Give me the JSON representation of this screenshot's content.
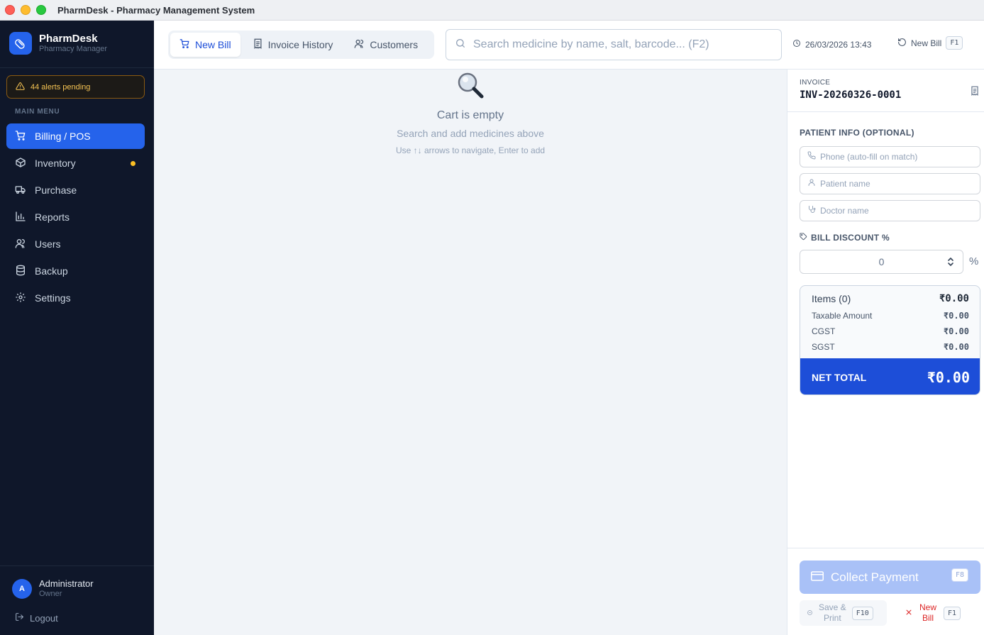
{
  "window": {
    "title": "PharmDesk - Pharmacy Management System"
  },
  "sidebar": {
    "brand_name": "PharmDesk",
    "brand_sub": "Pharmacy Manager",
    "alerts": "44 alerts pending",
    "menu_label": "MAIN MENU",
    "items": [
      {
        "label": "Billing / POS",
        "icon": "cart-icon",
        "active": true
      },
      {
        "label": "Inventory",
        "icon": "box-icon",
        "indicator": true
      },
      {
        "label": "Purchase",
        "icon": "truck-icon"
      },
      {
        "label": "Reports",
        "icon": "bar-chart-icon"
      },
      {
        "label": "Users",
        "icon": "users-icon"
      },
      {
        "label": "Backup",
        "icon": "database-icon"
      },
      {
        "label": "Settings",
        "icon": "gear-icon"
      }
    ],
    "user": {
      "initial": "A",
      "name": "Administrator",
      "role": "Owner"
    },
    "logout": "Logout"
  },
  "topbar": {
    "tabs": [
      {
        "label": "New Bill",
        "active": true
      },
      {
        "label": "Invoice History"
      },
      {
        "label": "Customers"
      }
    ],
    "search_placeholder": "Search medicine by name, salt, barcode... (F2)",
    "datetime": "26/03/2026 13:43",
    "new_bill_label": "New Bill",
    "new_bill_key": "F1"
  },
  "cart": {
    "empty_title": "Cart is empty",
    "empty_sub": "Search and add medicines above",
    "empty_hint": "Use ↑↓ arrows to navigate, Enter to add"
  },
  "panel": {
    "invoice_label": "INVOICE",
    "invoice_no": "INV-20260326-0001",
    "patient_label": "PATIENT INFO (OPTIONAL)",
    "phone_placeholder": "Phone (auto-fill on match)",
    "patient_placeholder": "Patient name",
    "doctor_placeholder": "Doctor name",
    "discount_label": "BILL DISCOUNT %",
    "discount_value": "0",
    "percent_sign": "%",
    "items_label": "Items (0)",
    "items_value": "₹0.00",
    "taxable_label": "Taxable Amount",
    "taxable_value": "₹0.00",
    "cgst_label": "CGST",
    "cgst_value": "₹0.00",
    "sgst_label": "SGST",
    "sgst_value": "₹0.00",
    "net_label": "NET TOTAL",
    "net_value": "₹0.00",
    "collect_label": "Collect Payment",
    "collect_key": "F8",
    "save_print_line1": "Save &",
    "save_print_line2": "Print",
    "save_print_key": "F10",
    "new_bill_line1": "New",
    "new_bill_line2": "Bill",
    "new_bill_key": "F1"
  },
  "colors": {
    "accent": "#2563eb",
    "sidebar_bg": "#0f172a",
    "alert": "#fbbf24",
    "danger": "#dc2626"
  }
}
